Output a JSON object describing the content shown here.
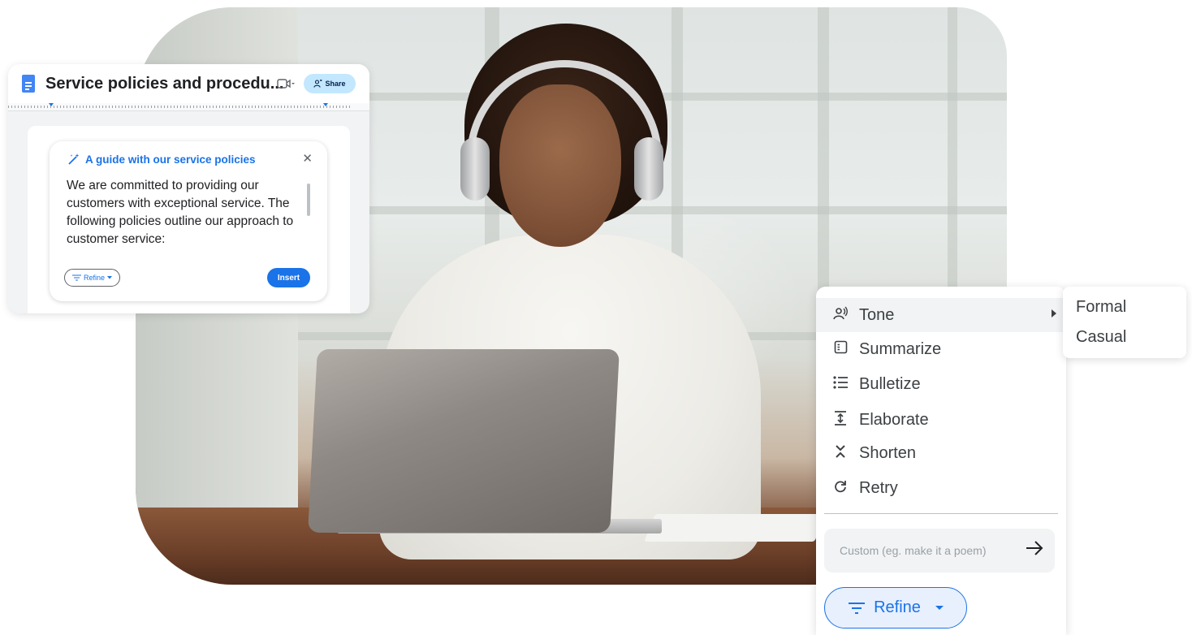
{
  "docs": {
    "title": "Service policies and procedu...",
    "share_label": "Share",
    "ai_card": {
      "title": "A guide with our service policies",
      "body": "We are committed to providing our customers with exceptional service. The following policies outline our approach to customer service:",
      "refine_label": "Refine",
      "insert_label": "Insert"
    }
  },
  "refine_menu": {
    "items": [
      {
        "label": "Tone",
        "icon": "tone-icon"
      },
      {
        "label": "Summarize",
        "icon": "summarize-icon"
      },
      {
        "label": "Bulletize",
        "icon": "bulletize-icon"
      },
      {
        "label": "Elaborate",
        "icon": "elaborate-icon"
      },
      {
        "label": "Shorten",
        "icon": "shorten-icon"
      },
      {
        "label": "Retry",
        "icon": "retry-icon"
      }
    ],
    "custom_placeholder": "Custom (eg. make it a poem)",
    "refine_label": "Refine"
  },
  "tone_submenu": {
    "options": [
      "Formal",
      "Casual"
    ]
  },
  "colors": {
    "accent": "#1a73e8",
    "share_bg": "#c2e7ff",
    "refine_bg": "#e8f0fe"
  }
}
